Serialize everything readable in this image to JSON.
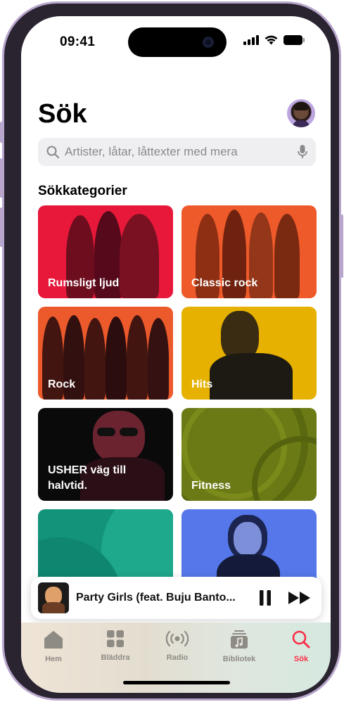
{
  "status_bar": {
    "time": "09:41"
  },
  "header": {
    "title": "Sök"
  },
  "search": {
    "placeholder": "Artister, låtar, låttexter med mera"
  },
  "section": {
    "title": "Sökkategorier"
  },
  "categories": [
    {
      "label": "Rumsligt ljud",
      "color": "#e8183b"
    },
    {
      "label": "Classic rock",
      "color": "#ef5a2a"
    },
    {
      "label": "Rock",
      "color": "#ec5a2b"
    },
    {
      "label": "Hits",
      "color": "#e6b100"
    },
    {
      "label": "USHER väg till\nhalvtid.",
      "color": "#0a0a0a"
    },
    {
      "label": "Fitness",
      "color": "#6b7a14"
    },
    {
      "label": "",
      "color": "#12937a"
    },
    {
      "label": "",
      "color": "#5577e9"
    }
  ],
  "mini_player": {
    "title": "Party Girls (feat. Buju Banto..."
  },
  "tabs": [
    {
      "label": "Hem",
      "icon": "house-icon",
      "active": false
    },
    {
      "label": "Bläddra",
      "icon": "grid-icon",
      "active": false
    },
    {
      "label": "Radio",
      "icon": "radio-icon",
      "active": false
    },
    {
      "label": "Bibliotek",
      "icon": "music-note-icon",
      "active": false
    },
    {
      "label": "Sök",
      "icon": "search-icon",
      "active": true
    }
  ],
  "colors": {
    "accent": "#fa2d48",
    "tab_inactive": "#8e8a84"
  }
}
